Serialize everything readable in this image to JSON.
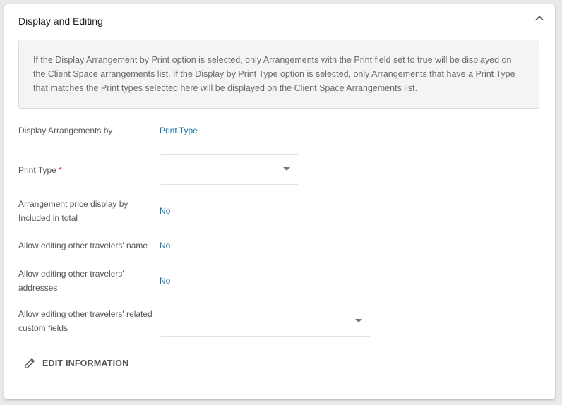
{
  "section": {
    "title": "Display and Editing",
    "info_text": "If the Display Arrangement by Print option is selected, only Arrangements with the Print field set to true will be displayed on the Client Space arrangements list. If the Display by Print Type option is selected, only Arrangements that have a Print Type that matches the Print types selected here will be displayed on the Client Space Arrangements list."
  },
  "fields": {
    "display_by": {
      "label": "Display Arrangements by",
      "value": "Print Type"
    },
    "print_type": {
      "label": "Print Type",
      "required_mark": "*",
      "value": ""
    },
    "price_display": {
      "label": "Arrangement price display by Included in total",
      "value": "No"
    },
    "edit_names": {
      "label": "Allow editing other travelers' name",
      "value": "No"
    },
    "edit_addresses": {
      "label": "Allow editing other travelers' addresses",
      "value": "No"
    },
    "edit_custom": {
      "label": "Allow editing other travelers' related custom fields",
      "value": ""
    }
  },
  "actions": {
    "edit_label": "EDIT INFORMATION"
  },
  "icons": {
    "collapse": "chevron-up-icon",
    "edit": "pencil-icon"
  },
  "colors": {
    "link": "#1a73a8",
    "required": "#d32f2f"
  }
}
